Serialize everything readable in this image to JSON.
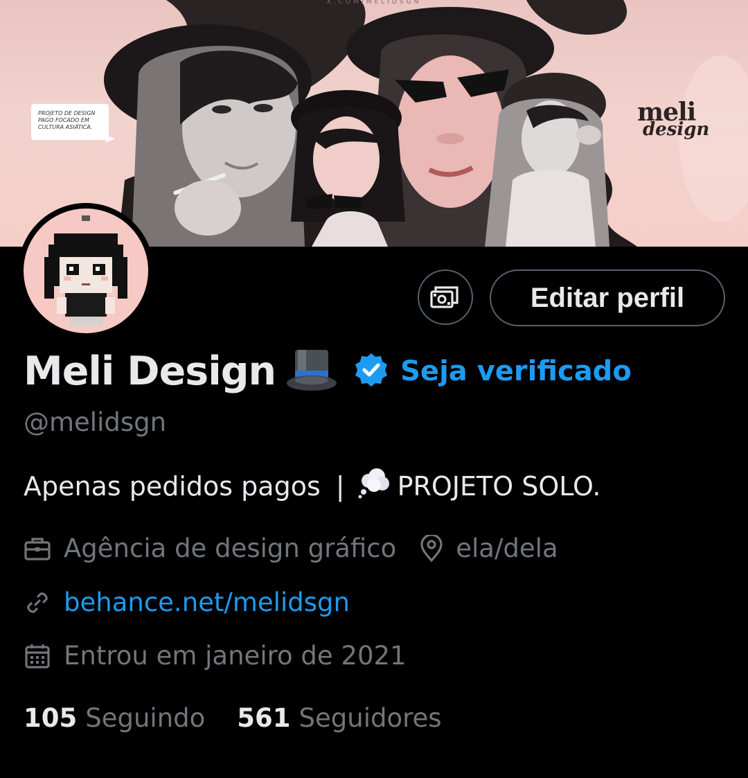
{
  "banner": {
    "top_text": "X.COM/MELIDSGN",
    "speech_card_lines": [
      "PROJETO DE DESIGN",
      "PAGO FOCADO EM",
      "CULTURA ASIÁTICA."
    ],
    "logo_line1": "meli",
    "logo_line2": "design"
  },
  "profile": {
    "display_name": "Meli Design",
    "name_emoji": "top-hat",
    "verify_label": "Seja verificado",
    "handle": "@melidsgn",
    "bio_part1": "Apenas pedidos pagos",
    "bio_separator": "|",
    "bio_part2": "PROJETO SOLO.",
    "category": "Agência de design gráfico",
    "location": "ela/dela",
    "website": "behance.net/melidsgn",
    "joined": "Entrou em janeiro de 2021"
  },
  "buttons": {
    "edit_profile": "Editar perfil",
    "monetization_icon": "money-icon"
  },
  "stats": {
    "following_count": "105",
    "following_label": "Seguindo",
    "followers_count": "561",
    "followers_label": "Seguidores"
  },
  "colors": {
    "background": "#000000",
    "text_primary": "#e7e9ea",
    "text_secondary": "#71767b",
    "accent": "#1d9bf0",
    "border": "#536471",
    "banner_pink": "#f2d2cd"
  },
  "icons": [
    "briefcase-icon",
    "location-pin-icon",
    "link-icon",
    "calendar-icon",
    "verified-badge-icon",
    "thought-bubble-icon"
  ]
}
